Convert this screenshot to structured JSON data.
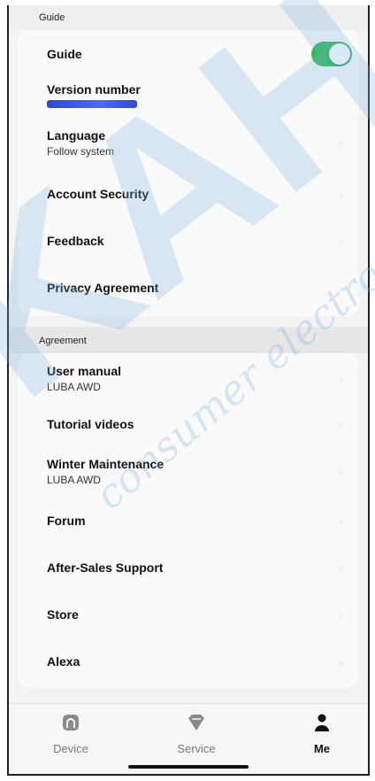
{
  "guide_section": {
    "header": "Guide",
    "items": [
      {
        "title": "Guide",
        "toggle_on": true
      },
      {
        "title": "Version number",
        "redacted": true
      },
      {
        "title": "Language",
        "subtitle": "Follow system"
      },
      {
        "title": "Account Security"
      },
      {
        "title": "Feedback"
      },
      {
        "title": "Privacy Agreement"
      }
    ]
  },
  "agreement_section": {
    "header": "Agreement",
    "items": [
      {
        "title": "User manual",
        "subtitle": "LUBA AWD"
      },
      {
        "title": "Tutorial videos"
      },
      {
        "title": "Winter Maintenance",
        "subtitle": "LUBA AWD"
      },
      {
        "title": "Forum"
      },
      {
        "title": "After-Sales Support"
      },
      {
        "title": "Store"
      },
      {
        "title": "Alexa"
      }
    ]
  },
  "tabbar": {
    "device": "Device",
    "service": "Service",
    "me": "Me",
    "active": "me"
  },
  "watermark": {
    "big_text": "KAH",
    "script_text": "consumer electronics"
  },
  "colors": {
    "toggle_on": "#33b85a",
    "redaction": "#2d46d9",
    "watermark": "#7fb4de"
  },
  "icons": {
    "device": "home-icon",
    "service": "shield-icon",
    "me": "person-icon"
  }
}
